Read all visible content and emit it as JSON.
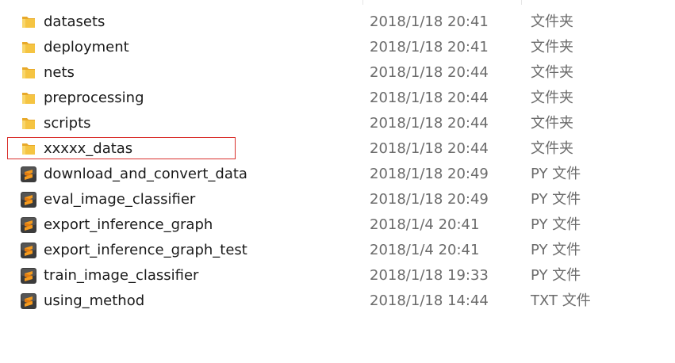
{
  "files": [
    {
      "name": "datasets",
      "date": "2018/1/18 20:41",
      "type": "文件夹",
      "icon": "folder-icon"
    },
    {
      "name": "deployment",
      "date": "2018/1/18 20:41",
      "type": "文件夹",
      "icon": "folder-icon"
    },
    {
      "name": "nets",
      "date": "2018/1/18 20:44",
      "type": "文件夹",
      "icon": "folder-icon"
    },
    {
      "name": "preprocessing",
      "date": "2018/1/18 20:44",
      "type": "文件夹",
      "icon": "folder-icon"
    },
    {
      "name": "scripts",
      "date": "2018/1/18 20:44",
      "type": "文件夹",
      "icon": "folder-icon"
    },
    {
      "name": "xxxxx_datas",
      "date": "2018/1/18 20:44",
      "type": "文件夹",
      "icon": "folder-icon",
      "highlighted": true
    },
    {
      "name": "download_and_convert_data",
      "date": "2018/1/18 20:49",
      "type": "PY 文件",
      "icon": "sublime-text-file-icon"
    },
    {
      "name": "eval_image_classifier",
      "date": "2018/1/18 20:49",
      "type": "PY 文件",
      "icon": "sublime-text-file-icon"
    },
    {
      "name": "export_inference_graph",
      "date": "2018/1/4 20:41",
      "type": "PY 文件",
      "icon": "sublime-text-file-icon"
    },
    {
      "name": "export_inference_graph_test",
      "date": "2018/1/4 20:41",
      "type": "PY 文件",
      "icon": "sublime-text-file-icon"
    },
    {
      "name": "train_image_classifier",
      "date": "2018/1/18 19:33",
      "type": "PY 文件",
      "icon": "sublime-text-file-icon"
    },
    {
      "name": "using_method",
      "date": "2018/1/18 14:44",
      "type": "TXT 文件",
      "icon": "sublime-text-file-icon"
    }
  ],
  "colors": {
    "folder": "#f5c442",
    "highlight_border": "#d9302c",
    "sublime_bg": "#3b3b3b",
    "sublime_accent": "#f59b1e"
  }
}
